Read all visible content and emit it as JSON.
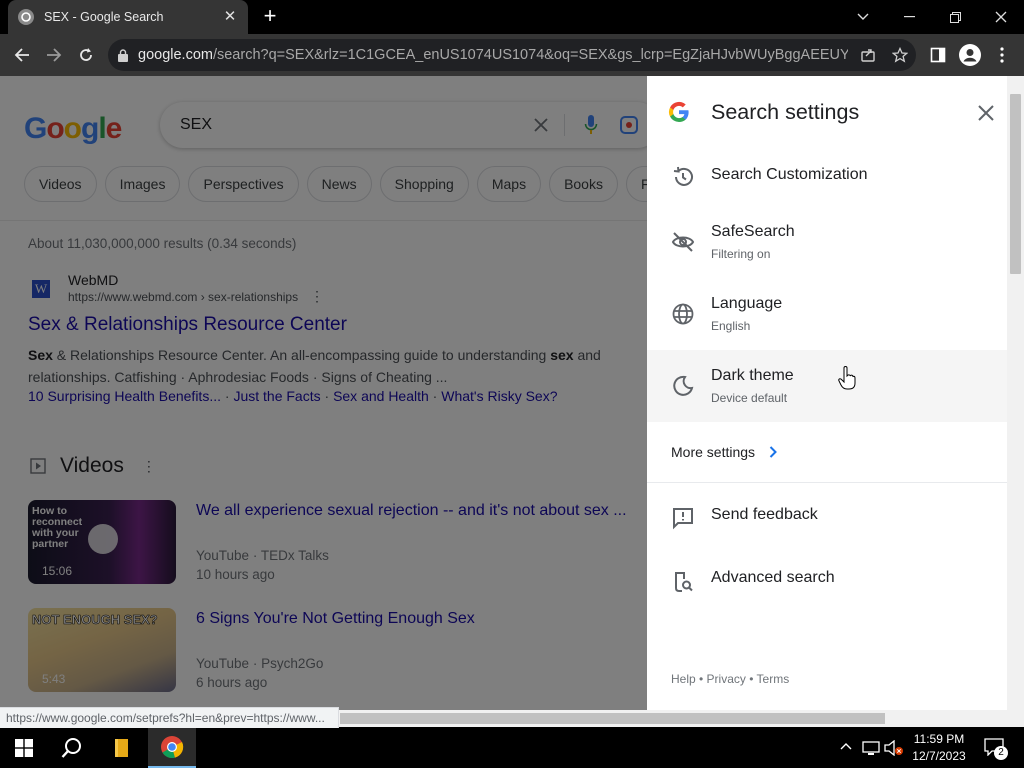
{
  "browser": {
    "tab_title": "SEX - Google Search",
    "url_domain": "google.com",
    "url_rest": "/search?q=SEX&rlz=1C1GCEA_enUS1074US1074&oq=SEX&gs_lcrp=EgZjaHJvbWUyBggAEEUYOdIBB..."
  },
  "page": {
    "logo_text": "Google",
    "query": "SEX",
    "chips": [
      "Videos",
      "Images",
      "Perspectives",
      "News",
      "Shopping",
      "Maps",
      "Books",
      "Flig"
    ],
    "stats": "About 11,030,000,000 results (0.34 seconds)",
    "result": {
      "favicon_letter": "W",
      "site": "WebMD",
      "crumb": "https://www.webmd.com › sex-relationships",
      "title": "Sex & Relationships Resource Center",
      "snippet_1a": "Sex",
      "snippet_1b": " & Relationships Resource Center. An all-encompassing guide to understanding ",
      "snippet_1c": "sex",
      "snippet_1d": " and",
      "snippet_2": "relationships. Catfishing · Aphrodesiac Foods · Signs of Cheating ...",
      "sitelinks": [
        "10 Surprising Health Benefits...",
        "Just the Facts",
        "Sex and Health",
        "What's Risky Sex?"
      ]
    },
    "videos_heading": "Videos",
    "videos": [
      {
        "title": "We all experience sexual rejection -- and it's not about sex ...",
        "source": "YouTube",
        "channel": "TEDx Talks",
        "age": "10 hours ago",
        "duration": "15:06",
        "thumb_caption": "How to reconnect with your partner"
      },
      {
        "title": "6 Signs You're Not Getting Enough Sex",
        "source": "YouTube",
        "channel": "Psych2Go",
        "age": "6 hours ago",
        "duration": "5:43",
        "thumb_caption": "NOT ENOUGH SEX?"
      }
    ],
    "status_url": "https://www.google.com/setprefs?hl=en&prev=https://www..."
  },
  "settings_panel": {
    "title": "Search settings",
    "items": [
      {
        "label": "Search Customization",
        "sub": ""
      },
      {
        "label": "SafeSearch",
        "sub": "Filtering on"
      },
      {
        "label": "Language",
        "sub": "English"
      },
      {
        "label": "Dark theme",
        "sub": "Device default"
      }
    ],
    "more_settings": "More settings",
    "send_feedback": "Send feedback",
    "advanced_search": "Advanced search",
    "footer": "Help • Privacy • Terms"
  },
  "taskbar": {
    "time": "11:59 PM",
    "date": "12/7/2023",
    "notification_count": "2"
  },
  "colors": {
    "link": "#1a0dab",
    "chrome_bg": "#353535",
    "accent_blue": "#4285f4"
  }
}
